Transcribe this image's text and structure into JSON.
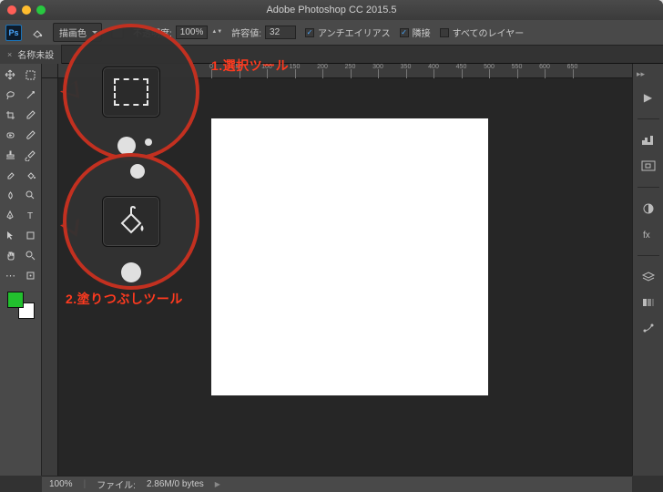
{
  "titlebar": {
    "title": "Adobe Photoshop CC 2015.5"
  },
  "options": {
    "fill_mode_label": "描画色",
    "opacity_label": "不透明度:",
    "opacity_value": "100%",
    "tolerance_label": "許容値:",
    "tolerance_value": "32",
    "antialias_label": "アンチエイリアス",
    "antialias_checked": true,
    "contiguous_label": "隣接",
    "contiguous_checked": true,
    "all_layers_label": "すべてのレイヤー",
    "all_layers_checked": false
  },
  "doctab": {
    "name": "名称未設",
    "close": "×"
  },
  "ruler": {
    "ticks": [
      0,
      50,
      100,
      150,
      200,
      250,
      300,
      350,
      400,
      450,
      500,
      550,
      600,
      650
    ]
  },
  "swatch": {
    "fg": "#22c02e",
    "bg": "#ffffff"
  },
  "status": {
    "zoom": "100%",
    "filesize_label": "ファイル:",
    "filesize": "2.86M/0 bytes"
  },
  "annotations": {
    "label1": "1.選択ツール",
    "label2": "2.塗りつぶしツール"
  },
  "tools": [
    "move",
    "marquee",
    "lasso",
    "magic-wand",
    "crop",
    "eyedropper",
    "healing",
    "brush",
    "stamp",
    "history-brush",
    "eraser",
    "paint-bucket",
    "blur",
    "dodge",
    "pen",
    "type",
    "path-select",
    "rectangle",
    "hand",
    "zoom",
    "edit-toolbar",
    "more"
  ],
  "dock_icons": [
    "play",
    "histogram",
    "adjustments",
    "character",
    "paragraph",
    "layers",
    "channels",
    "paths"
  ]
}
